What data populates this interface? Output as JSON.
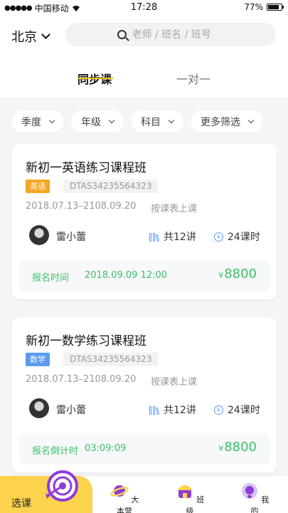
{
  "status_bar": {
    "carrier": "中国移动",
    "time": "17:28",
    "battery": "77%"
  },
  "header": {
    "city": "北京",
    "search_placeholder": "老师 / 班名 / 班号",
    "tabs": [
      {
        "label": "同步课",
        "active": true
      },
      {
        "label": "一对一",
        "active": false
      }
    ]
  },
  "filters": [
    {
      "label": "季度"
    },
    {
      "label": "年级"
    },
    {
      "label": "科目"
    },
    {
      "label": "更多筛选"
    }
  ],
  "courses": [
    {
      "title": "新初一英语练习课程班",
      "subject_tag": "英语",
      "tag_color": "#f5a623",
      "code": "DTAS34235564323",
      "date_range": "2018.07.13–2108.09.20",
      "schedule": "按课表上课",
      "teacher": "雷小蕾",
      "lessons": "共12讲",
      "hours": "24课时",
      "footer_label": "报名时间",
      "footer_value": "2018.09.09  12:00",
      "price_symbol": "¥",
      "price": "8800"
    },
    {
      "title": "新初一数学练习课程班",
      "subject_tag": "数学",
      "tag_color": "#5b9bf0",
      "code": "DTAS34235564323",
      "date_range": "2018.07.13–2108.09.20",
      "schedule": "按课表上课",
      "teacher": "雷小蕾",
      "lessons": "共12讲",
      "hours": "24课时",
      "footer_label": "报名倒计时",
      "footer_value": "03:09:09",
      "price_symbol": "¥",
      "price": "8800"
    }
  ],
  "tabbar": {
    "items": [
      {
        "label": "选课",
        "icon": "target-icon",
        "active": true
      },
      {
        "label": "大本营",
        "icon": "planet-icon"
      },
      {
        "label": "班级",
        "icon": "class-icon"
      },
      {
        "label": "我的",
        "icon": "profile-icon"
      }
    ]
  }
}
